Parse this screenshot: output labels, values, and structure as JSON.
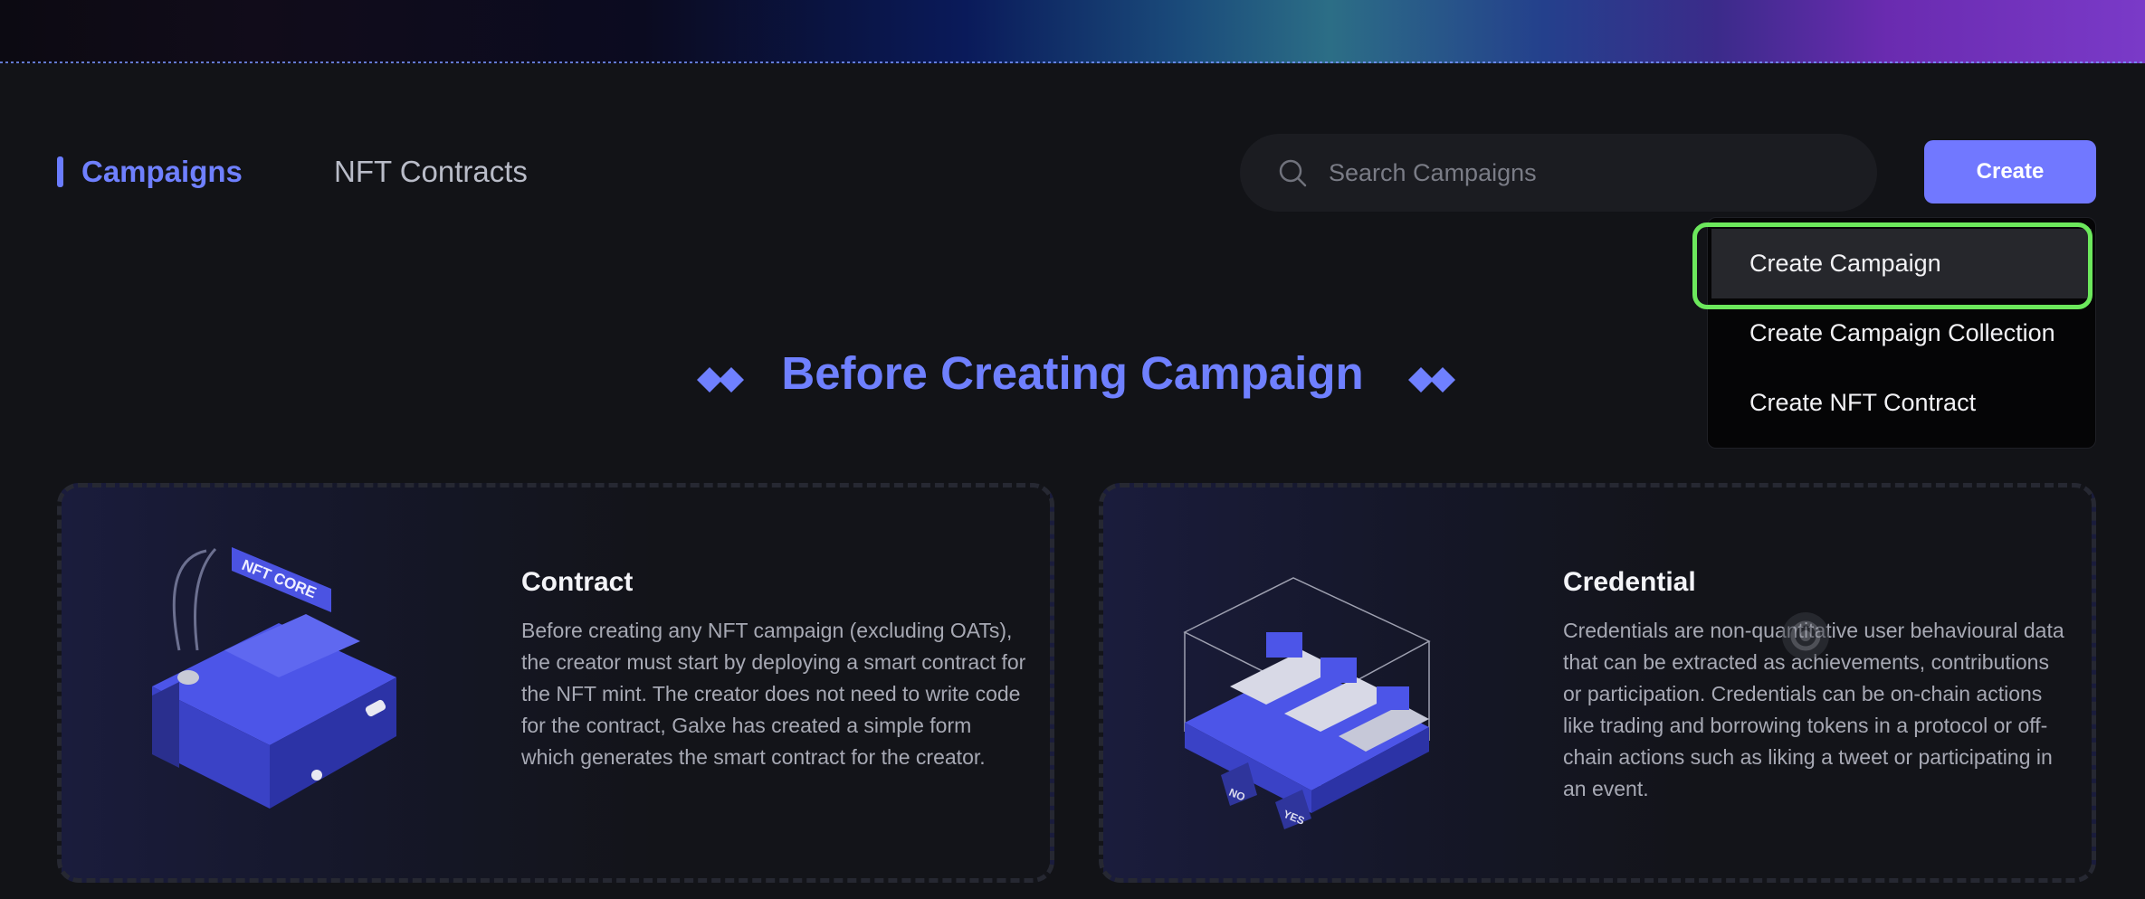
{
  "nav": {
    "tabs": [
      {
        "label": "Campaigns",
        "active": true
      },
      {
        "label": "NFT Contracts",
        "active": false
      }
    ]
  },
  "search": {
    "placeholder": "Search Campaigns",
    "value": ""
  },
  "create_button": {
    "label": "Create"
  },
  "dropdown": {
    "items": [
      {
        "label": "Create Campaign",
        "highlighted": true
      },
      {
        "label": "Create Campaign Collection",
        "highlighted": false
      },
      {
        "label": "Create NFT Contract",
        "highlighted": false
      }
    ]
  },
  "section": {
    "title": "Before Creating Campaign"
  },
  "cards": [
    {
      "title": "Contract",
      "text": "Before creating any NFT campaign (excluding OATs), the creator must start by deploying a smart contract for the NFT mint. The creator does not need to write code for the contract, Galxe has created a simple form which generates the smart contract for the creator.",
      "illustration_label": "NFT CORE",
      "icon": "nft-core-machine-illustration"
    },
    {
      "title": "Credential",
      "text": "Credentials are non-quantitative user behavioural data that can be extracted as achievements, contributions or participation. Credentials can be on-chain actions like trading and borrowing tokens in a protocol or off-chain actions such as liking a tweet or participating in an event.",
      "illustration_labels": [
        "NO",
        "YES"
      ],
      "icon": "credential-box-illustration"
    }
  ],
  "colors": {
    "accent": "#6f80ff",
    "button": "#7178ff",
    "highlight_ring": "#6ce85c",
    "background": "#121317"
  }
}
